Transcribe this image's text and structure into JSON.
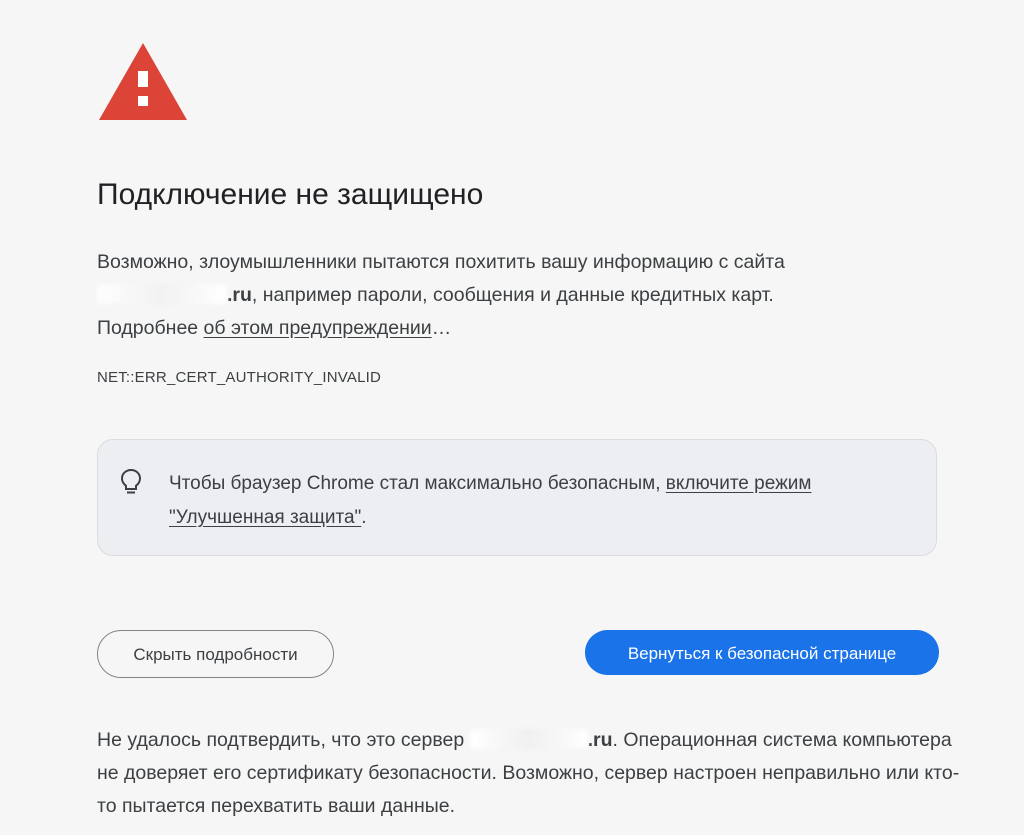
{
  "colors": {
    "background": "#f6f6f6",
    "warning_red": "#db4437",
    "primary_blue": "#1a73e8",
    "text": "#3c4043",
    "title_text": "#202124",
    "promo_bg": "#eceef1"
  },
  "icons": {
    "warning": "warning-triangle-icon",
    "tip": "lightbulb-icon"
  },
  "heading": {
    "title": "Подключение не защищено"
  },
  "intro": {
    "line1": "Возможно, злоумышленники пытаются похитить вашу информацию с сайта",
    "host_suffix": ".ru",
    "line2_rest": ", например пароли, сообщения и данные кредитных карт.",
    "learn_more_prefix": "Подробнее ",
    "learn_more_link": "об этом предупреждении",
    "learn_more_suffix": "…"
  },
  "error": {
    "code": "NET::ERR_CERT_AUTHORITY_INVALID"
  },
  "promo": {
    "text": "Чтобы браузер Chrome стал максимально безопасным, ",
    "link": "включите режим \"Улучшенная защита\"",
    "suffix": "."
  },
  "buttons": {
    "hide_details": "Скрыть подробности",
    "back_to_safety": "Вернуться к безопасной странице"
  },
  "details": {
    "prefix": "Не удалось подтвердить, что это сервер ",
    "host_suffix": ".ru",
    "rest": ". Операционная система компьютера не доверяет его сертификату безопасности. Возможно, сервер настроен неправильно или кто-то пытается перехватить ваши данные."
  }
}
